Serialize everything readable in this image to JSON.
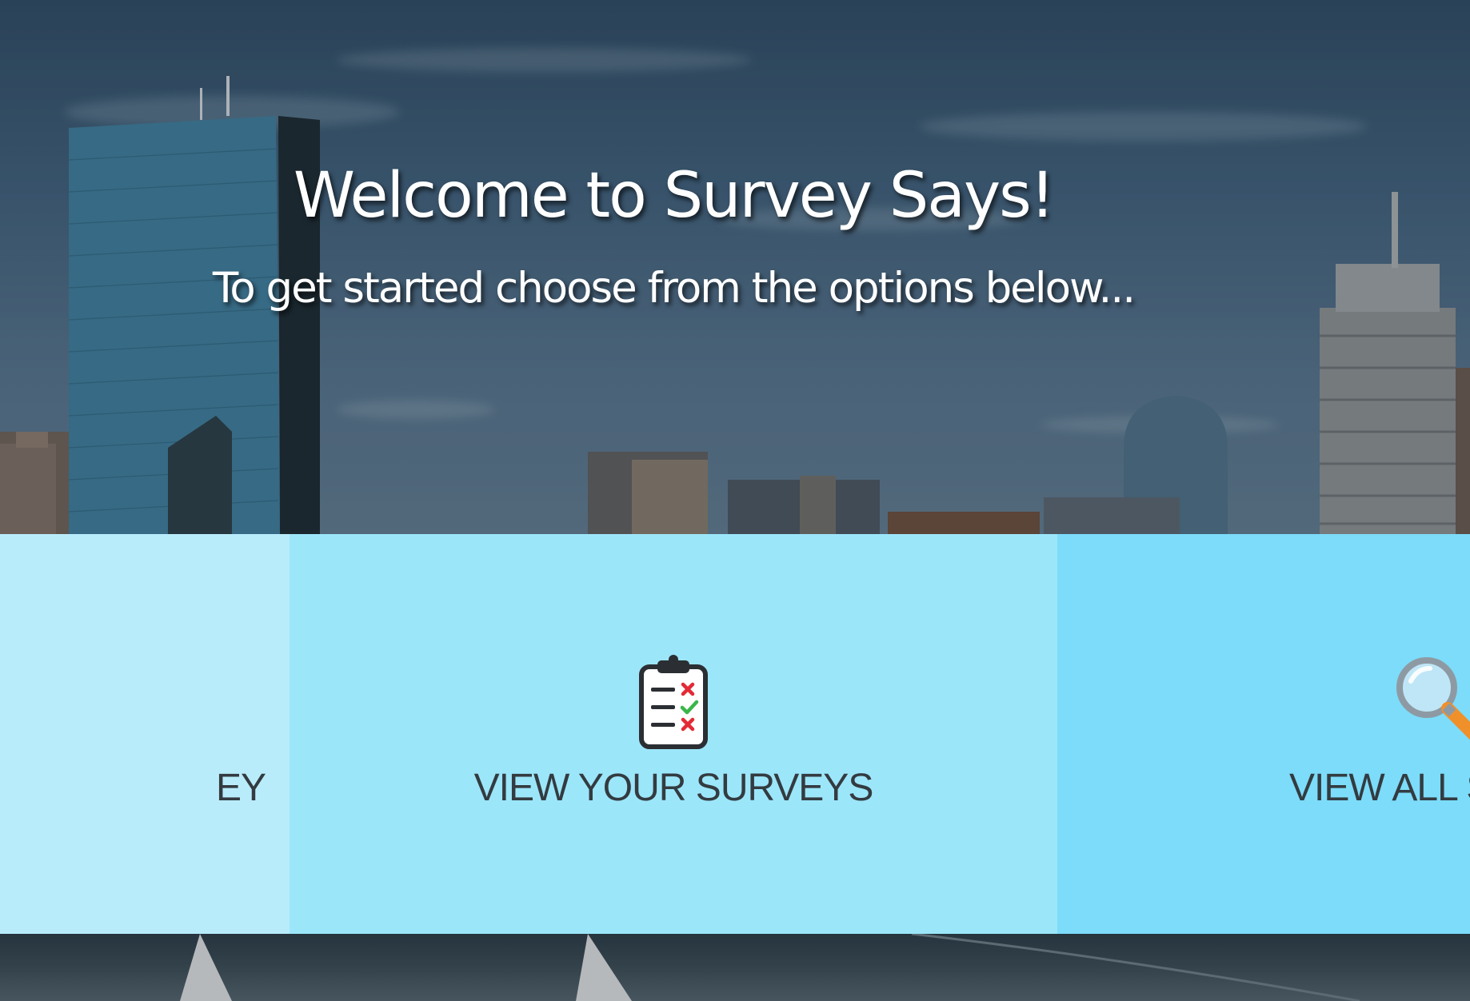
{
  "hero": {
    "title": "Welcome to Survey Says!",
    "subtitle": "To get started choose from the options below..."
  },
  "options": [
    {
      "label": "CREATE A SURVEY",
      "visible_text": "EY",
      "icon": null
    },
    {
      "label": "VIEW YOUR SURVEYS",
      "visible_text": "VIEW YOUR SURVEYS",
      "icon": "clipboard-checklist-icon"
    },
    {
      "label": "VIEW ALL SURVEYS",
      "visible_text": "VIEW ALL SU",
      "icon": "magnifying-glass-icon"
    }
  ],
  "colors": {
    "panel_create": "#b9ecfb",
    "panel_yours": "#9ce6fa",
    "panel_all": "#7cdcfa",
    "label_text": "#333b40",
    "hero_text": "#ffffff"
  }
}
